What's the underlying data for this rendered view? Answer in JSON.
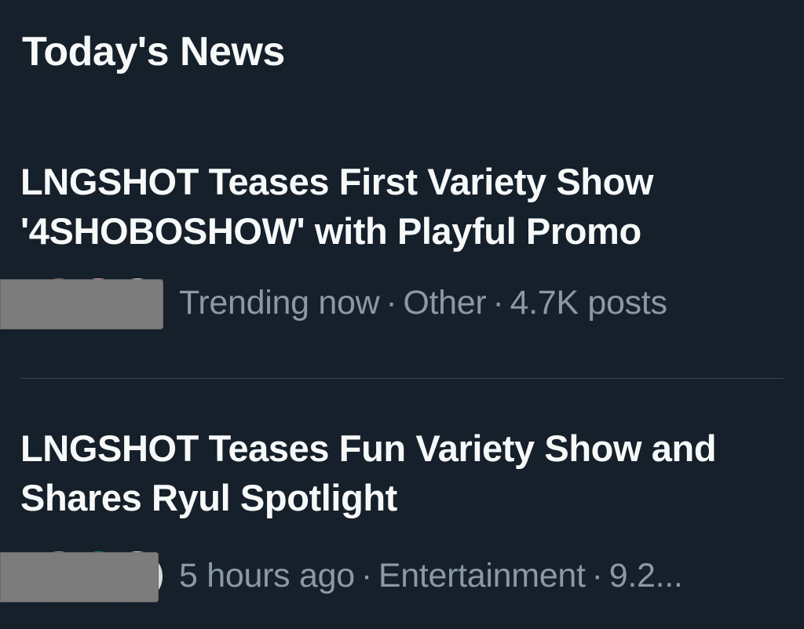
{
  "section": {
    "title": "Today's News"
  },
  "news": [
    {
      "headline": "LNGSHOT Teases First Variety Show '4SHOBOSHOW' with Playful Promo",
      "meta": {
        "time": "Trending now",
        "category": "Other",
        "count": "4.7K posts"
      },
      "avatar_colors": [
        "#8a7a6a",
        "#e8b4b8",
        "#d9d9d9"
      ]
    },
    {
      "headline": "LNGSHOT Teases Fun Variety Show and Shares Ryul Spotlight",
      "meta": {
        "time": "5 hours ago",
        "category": "Entertainment",
        "count": "9.2..."
      },
      "avatar_colors": [
        "#9a9a9a",
        "#1f8a5a",
        "#d9d9d9"
      ]
    }
  ],
  "colors": {
    "background": "#15202b",
    "headline": "#f7f9f9",
    "meta": "#8b98a5",
    "divider": "#38444d"
  },
  "meta_separator": "·"
}
